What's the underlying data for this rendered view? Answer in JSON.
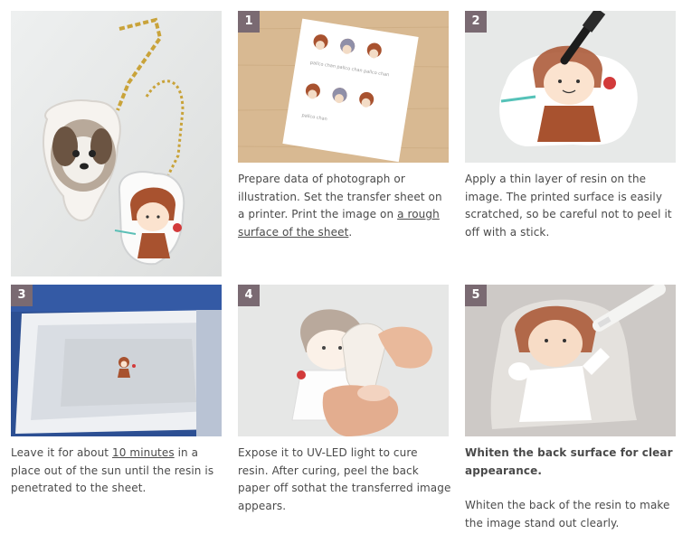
{
  "steps": [
    {
      "num": "1",
      "text_a": "Prepare data of photograph or illustration. Set the transfer sheet on a printer. Print the image on ",
      "link": "a rough surface of the sheet",
      "text_b": "."
    },
    {
      "num": "2",
      "text": "Apply a thin layer of resin on the image. The printed surface is easily scratched, so be careful not to peel it off with a stick."
    },
    {
      "num": "3",
      "text_a": "Leave it for about ",
      "link": "10 minutes",
      "text_b": " in a place out of the sun until the resin is penetrated to the sheet."
    },
    {
      "num": "4",
      "text": "Expose it to UV-LED light to cure resin. After curing, peel the back paper off sothat the transferred image appears."
    },
    {
      "num": "5",
      "heading": "Whiten the back surface for clear appearance.",
      "text": "Whiten the back of the resin to make the image stand out clearly."
    }
  ],
  "sheet_labels": [
    "pallco chan",
    "pallco chan",
    "pallco chan",
    "pallco chan"
  ],
  "colors": {
    "badge": "#7a6a72",
    "text": "#4a4a4a"
  }
}
